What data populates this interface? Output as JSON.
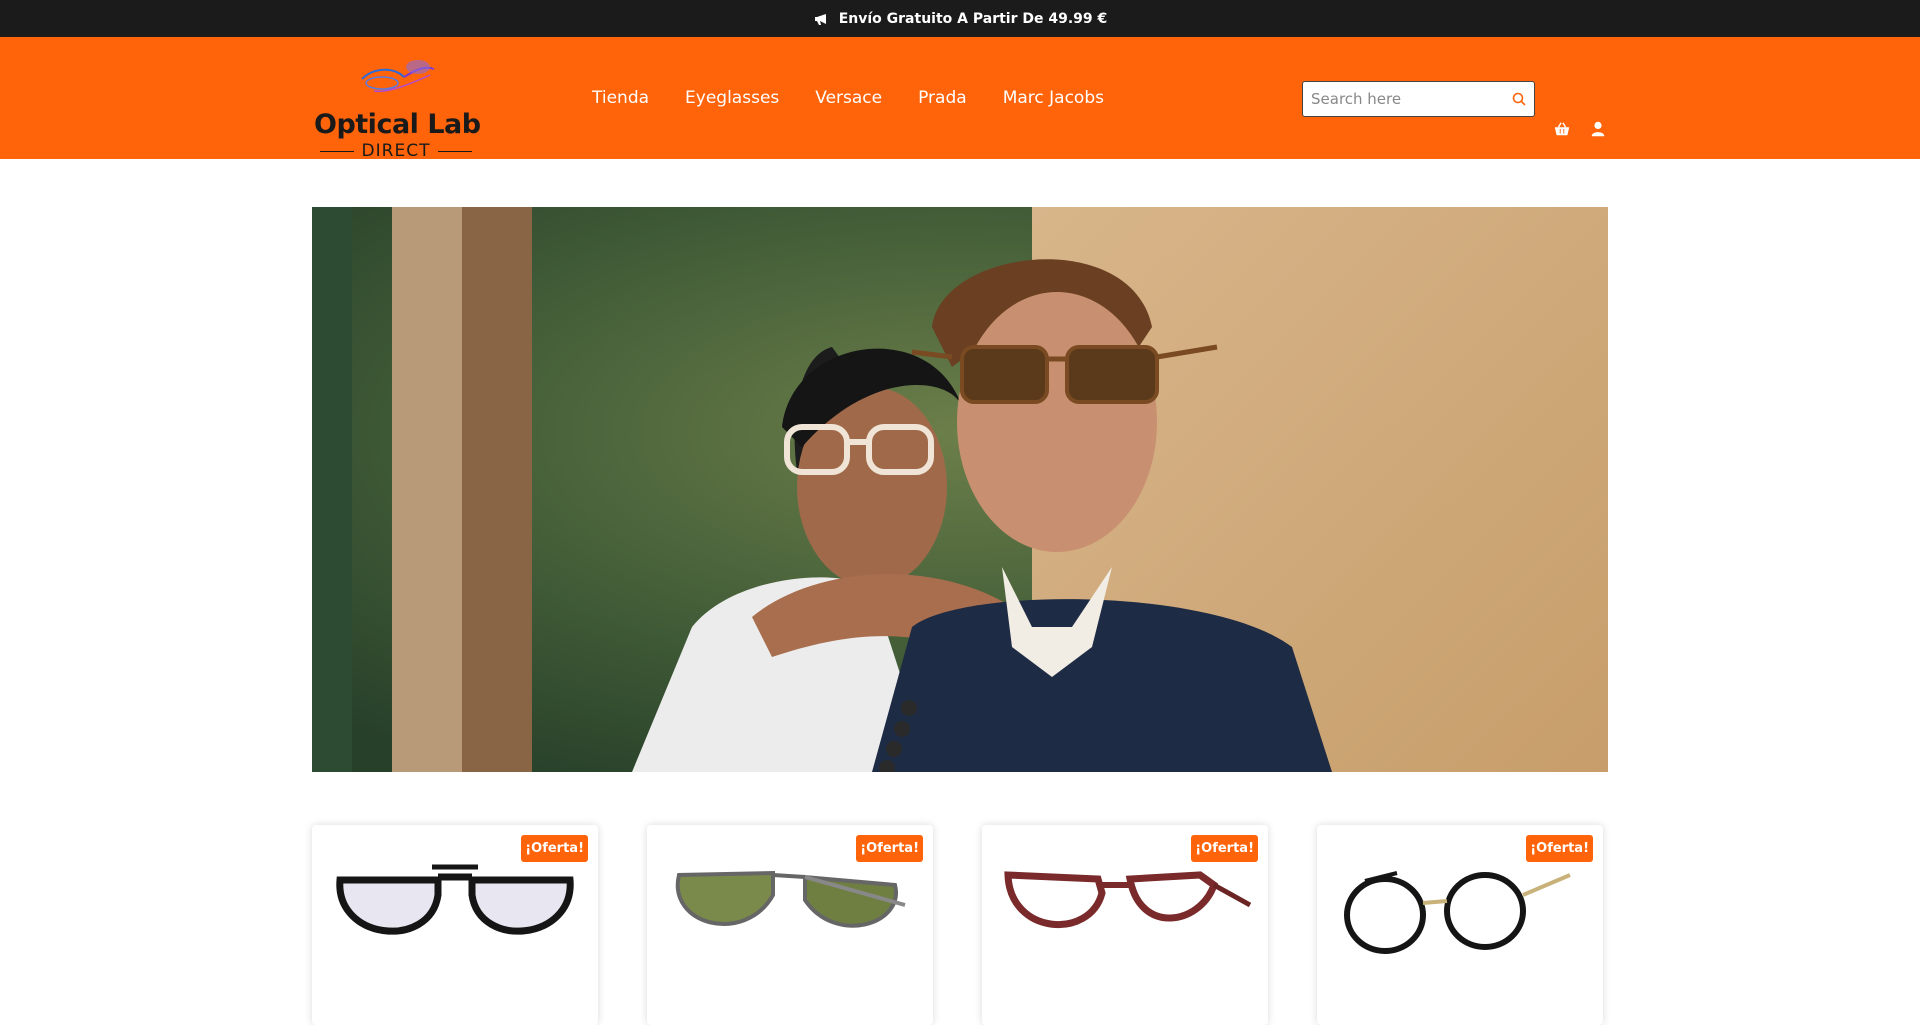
{
  "announcement": {
    "icon": "megaphone-icon",
    "text": "Envío Gratuito A Partir De 49.99 €"
  },
  "brand": {
    "title": "Optical Lab",
    "subtitle": "DIRECT"
  },
  "nav": {
    "items": [
      "Tienda",
      "Eyeglasses",
      "Versace",
      "Prada",
      "Marc Jacobs"
    ]
  },
  "search": {
    "placeholder": "Search here",
    "icon": "search-icon"
  },
  "header_icons": {
    "basket": "basket-icon",
    "user": "user-icon"
  },
  "products": [
    {
      "badge": "¡Oferta!",
      "name": ""
    },
    {
      "badge": "¡Oferta!",
      "name": ""
    },
    {
      "badge": "¡Oferta!",
      "name": ""
    },
    {
      "badge": "¡Oferta!",
      "name": ""
    }
  ],
  "colors": {
    "accent": "#ff640a",
    "topbar": "#1b1b1b"
  }
}
